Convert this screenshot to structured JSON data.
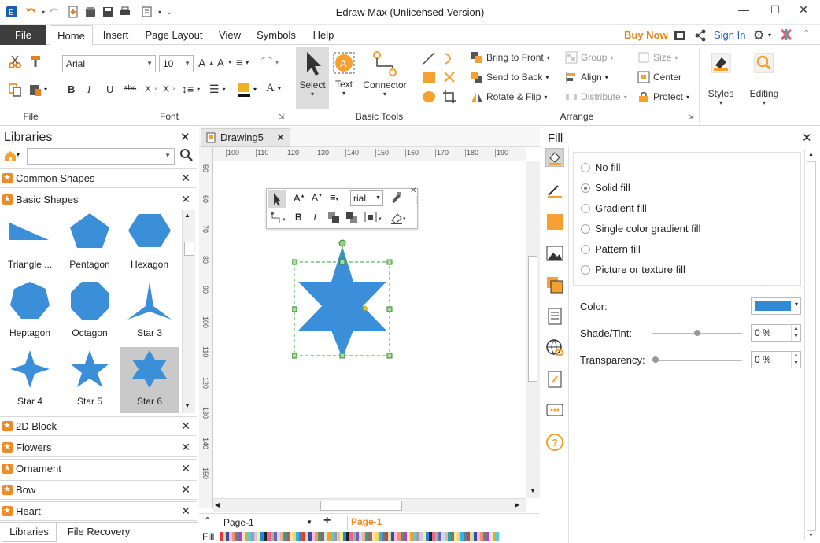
{
  "app": {
    "title": "Edraw Max (Unlicensed Version)"
  },
  "menu": {
    "file": "File",
    "tabs": [
      "Home",
      "Insert",
      "Page Layout",
      "View",
      "Symbols",
      "Help"
    ],
    "buy_now": "Buy Now",
    "sign_in": "Sign In"
  },
  "ribbon": {
    "groups": {
      "file": "File",
      "font": "Font",
      "basic_tools": "Basic Tools",
      "arrange": "Arrange"
    },
    "font_name": "Arial",
    "font_size": "10",
    "tools": {
      "select": "Select",
      "text": "Text",
      "connector": "Connector"
    },
    "arrange": {
      "bring_to_front": "Bring to Front",
      "send_to_back": "Send to Back",
      "rotate_flip": "Rotate & Flip",
      "group": "Group",
      "align": "Align",
      "distribute": "Distribute",
      "size": "Size",
      "center": "Center",
      "protect": "Protect"
    },
    "styles": "Styles",
    "editing": "Editing"
  },
  "libraries": {
    "title": "Libraries",
    "sections_top": [
      "Common Shapes",
      "Basic Shapes"
    ],
    "shapes": [
      "Triangle ...",
      "Pentagon",
      "Hexagon",
      "Heptagon",
      "Octagon",
      "Star 3",
      "Star 4",
      "Star 5",
      "Star 6"
    ],
    "sections_bottom": [
      "2D Block",
      "Flowers",
      "Ornament",
      "Bow",
      "Heart"
    ],
    "bottom_tabs": [
      "Libraries",
      "File Recovery"
    ]
  },
  "document": {
    "tab": "Drawing5",
    "ruler_h": [
      "100",
      "110",
      "120",
      "130",
      "140",
      "150",
      "160",
      "170",
      "180",
      "190"
    ],
    "ruler_v": [
      "50",
      "60",
      "70",
      "80",
      "90",
      "100",
      "110",
      "120",
      "130",
      "140",
      "150"
    ],
    "mini_font": "rial",
    "page_select": "Page-1",
    "page_tab": "Page-1",
    "fill_label": "Fill"
  },
  "fill_panel": {
    "title": "Fill",
    "options": [
      "No fill",
      "Solid fill",
      "Gradient fill",
      "Single color gradient fill",
      "Pattern fill",
      "Picture or texture fill"
    ],
    "selected": "Solid fill",
    "color_label": "Color:",
    "color_value": "#2f8ad8",
    "shade_label": "Shade/Tint:",
    "shade_value": "0 %",
    "transparency_label": "Transparency:",
    "transparency_value": "0 %"
  },
  "colors": {
    "accent": "#3a8fd8",
    "star_fill": "#3a8fd8",
    "orange": "#f5a030"
  }
}
